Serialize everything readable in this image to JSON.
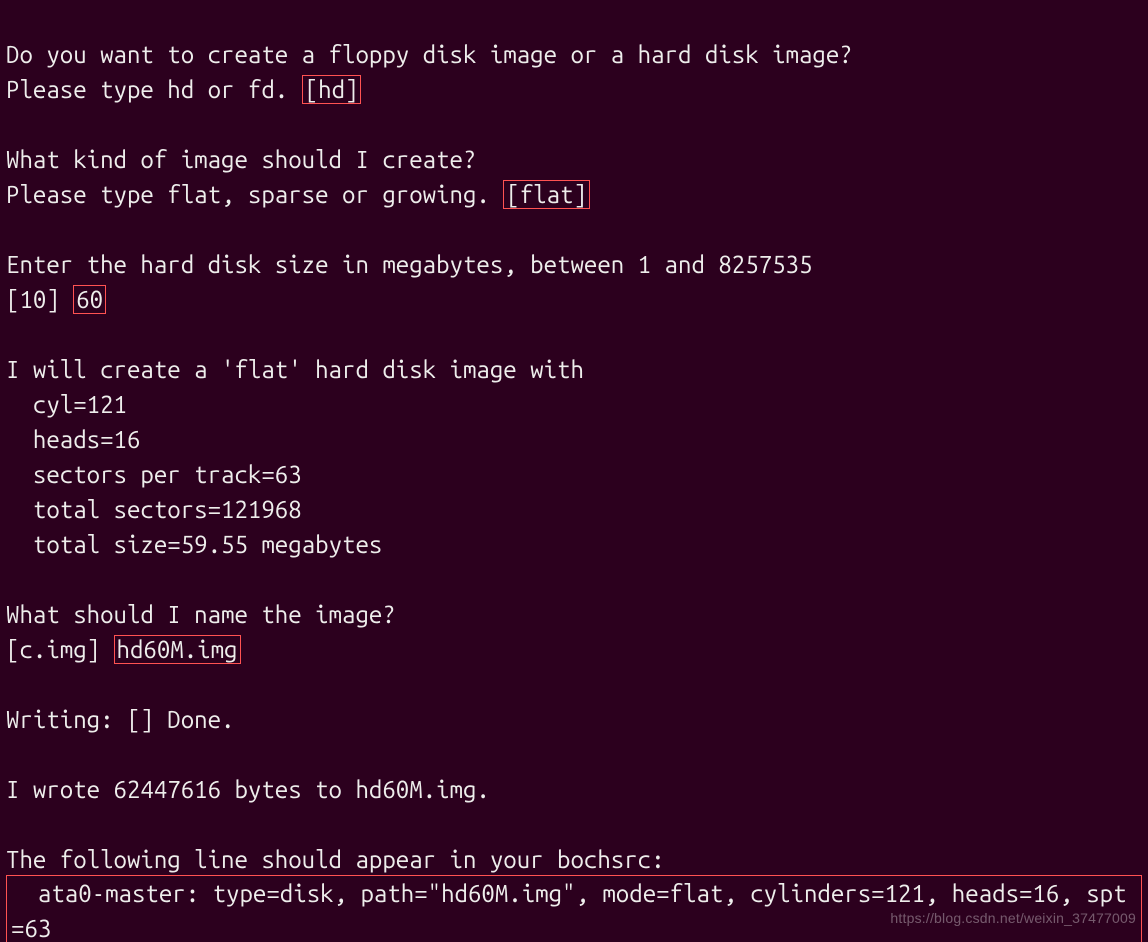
{
  "prompt_disk_type_q": "Do you want to create a floppy disk image or a hard disk image?",
  "prompt_disk_type_input_prefix": "Please type hd or fd. ",
  "prompt_disk_type_default": "[hd]",
  "prompt_image_kind_q": "What kind of image should I create?",
  "prompt_image_kind_input_prefix": "Please type flat, sparse or growing. ",
  "prompt_image_kind_default": "[flat]",
  "prompt_size_q": "Enter the hard disk size in megabytes, between 1 and 8257535",
  "prompt_size_default": "[10] ",
  "prompt_size_value": "60",
  "create_header": "I will create a 'flat' hard disk image with",
  "cyl_line": "  cyl=121",
  "heads_line": "  heads=16",
  "spt_line": "  sectors per track=63",
  "total_sectors_line": "  total sectors=121968",
  "total_size_line": "  total size=59.55 megabytes",
  "prompt_name_q": "What should I name the image?",
  "prompt_name_default": "[c.img] ",
  "prompt_name_value": "hd60M.img",
  "writing_line": "Writing: [] Done.",
  "wrote_line": "I wrote 62447616 bytes to hd60M.img.",
  "bochsrc_header": "The following line should appear in your bochsrc:",
  "bochsrc_line": "  ata0-master: type=disk, path=\"hd60M.img\", mode=flat, cylinders=121, heads=16, spt=63",
  "watermark": "https://blog.csdn.net/weixin_37477009"
}
